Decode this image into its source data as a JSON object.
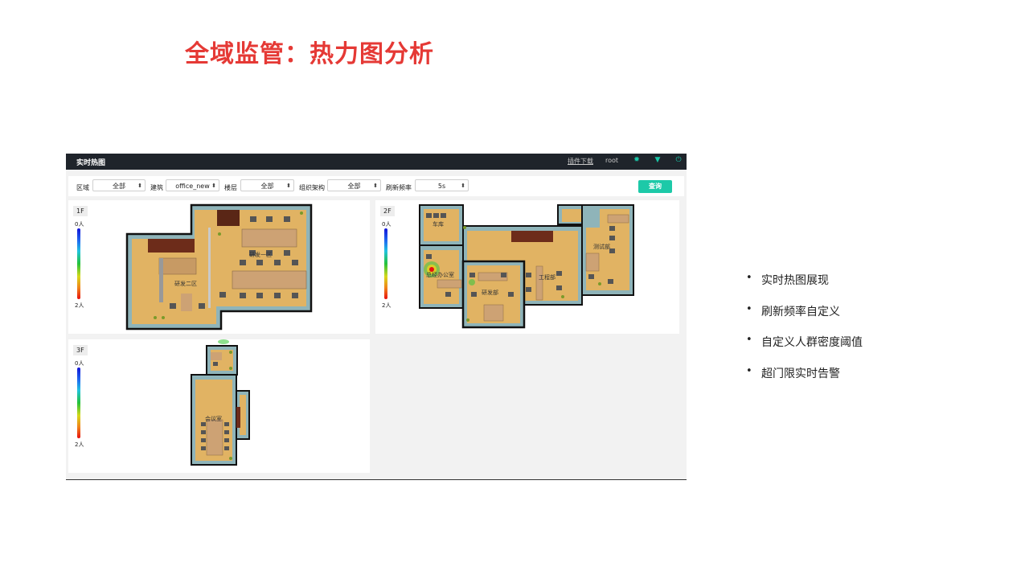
{
  "slide": {
    "title": "全域监管：热力图分析",
    "bullets": [
      "实时热图展现",
      "刷新频率自定义",
      "自定义人群密度阈值",
      "超门限实时告警"
    ]
  },
  "app": {
    "title": "实时热图",
    "plugin_link": "插件下载",
    "user": "root",
    "icons": [
      "settings-icon",
      "shirt-icon",
      "power-icon"
    ],
    "accent_color": "#1dc9a8",
    "topbar_color": "#1f242b"
  },
  "filters": {
    "region_label": "区域",
    "region_value": "全部",
    "building_label": "建筑",
    "building_value": "office_new",
    "floor_label": "楼层",
    "floor_value": "全部",
    "org_label": "组织架构",
    "org_value": "全部",
    "refresh_label": "刷新频率",
    "refresh_value": "5s",
    "query_button": "查询"
  },
  "legend": {
    "min_label": "0人",
    "max_label": "2人"
  },
  "floors": [
    {
      "tag": "1F",
      "rooms": [
        "研发一区",
        "研发二区"
      ]
    },
    {
      "tag": "2F",
      "rooms": [
        "车库",
        "总经办公室",
        "研发部",
        "工程部",
        "测试部"
      ]
    },
    {
      "tag": "3F",
      "rooms": [
        "会议室"
      ]
    }
  ]
}
